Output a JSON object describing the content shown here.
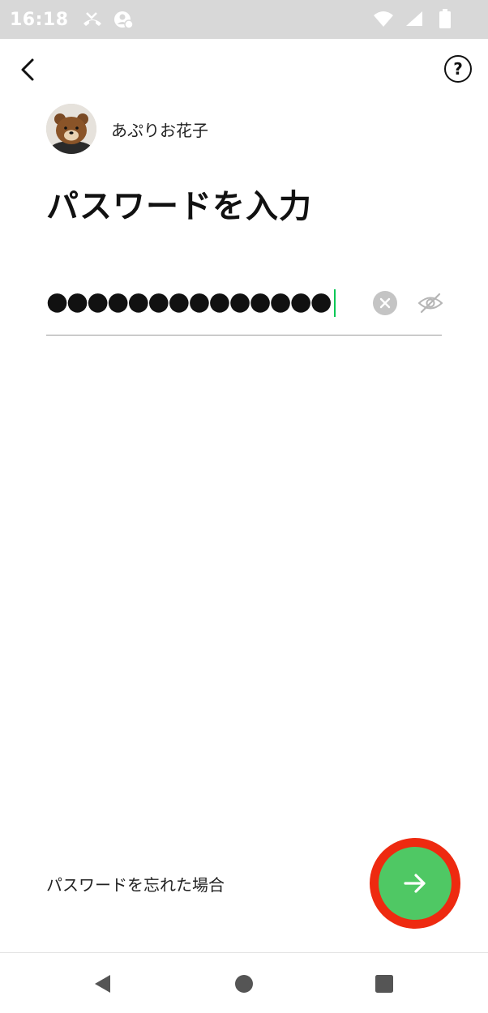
{
  "status_bar": {
    "time": "16:18",
    "icons": [
      "missed-call-icon",
      "account-sync-icon",
      "wifi-icon",
      "signal-icon",
      "battery-icon"
    ]
  },
  "header": {
    "back_icon": "chevron-left-icon",
    "help_label": "?"
  },
  "account": {
    "name": "あぷりお花子",
    "avatar_icon": "bear-avatar-icon"
  },
  "page": {
    "title": "パスワードを入力"
  },
  "password_field": {
    "masked_value": "●●●●●●●●●●●●●●",
    "clear_icon": "clear-circle-icon",
    "visibility_icon": "eye-off-icon"
  },
  "actions": {
    "forgot_password_label": "パスワードを忘れた場合",
    "next_icon": "arrow-right-icon"
  },
  "colors": {
    "accent_green": "#4fc864",
    "caret_green": "#06c755",
    "highlight_red": "#ee2a10",
    "status_bar_bg": "#d8d8d8"
  },
  "nav_bar": {
    "buttons": [
      "nav-back-icon",
      "nav-home-icon",
      "nav-recents-icon"
    ]
  }
}
